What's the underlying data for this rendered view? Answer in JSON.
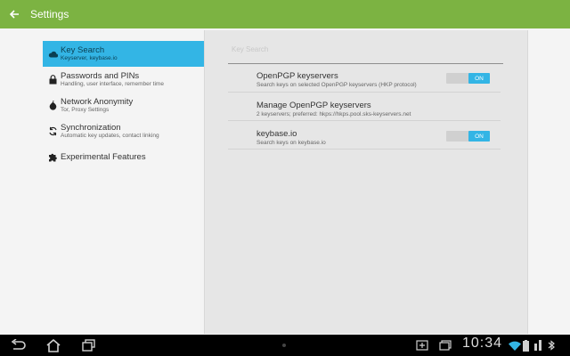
{
  "appbar": {
    "title": "Settings"
  },
  "sidebar": {
    "items": [
      {
        "label": "Key Search",
        "sub": "Keyserver, keybase.io"
      },
      {
        "label": "Passwords and PINs",
        "sub": "Handling, user interface, remember time"
      },
      {
        "label": "Network Anonymity",
        "sub": "Tor, Proxy Settings"
      },
      {
        "label": "Synchronization",
        "sub": "Automatic key updates, contact linking"
      },
      {
        "label": "Experimental Features",
        "sub": ""
      }
    ]
  },
  "panel": {
    "title": "Key Search",
    "prefs": [
      {
        "title": "OpenPGP keyservers",
        "sub": "Search keys on selected OpenPGP keyservers (HKP protocol)",
        "toggle": "ON"
      },
      {
        "title": "Manage OpenPGP keyservers",
        "sub": "2 keyservers; preferred: hkps://hkps.pool.sks-keyservers.net"
      },
      {
        "title": "keybase.io",
        "sub": "Search keys on keybase.io",
        "toggle": "ON"
      }
    ]
  },
  "statusbar": {
    "time": "10:34"
  },
  "colors": {
    "appbar": "#7cb342",
    "accent": "#33b5e5"
  }
}
